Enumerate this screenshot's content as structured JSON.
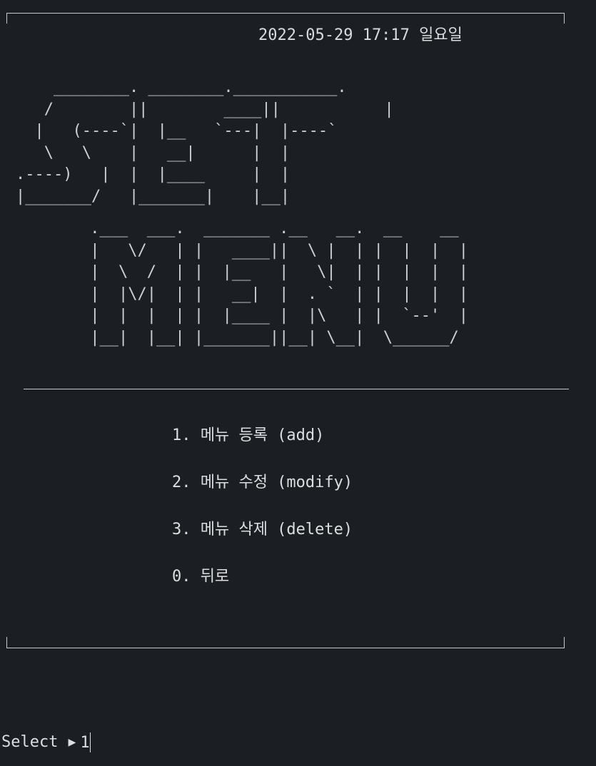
{
  "header": {
    "datetime": "2022-05-29 17:17 일요일"
  },
  "banner": {
    "set_art": "    ________. ________.___________.\n   /        ||        ____||           |\n  |   (----`|  |__   `---|  |----`\n   \\   \\    |   __|      |  |\n.----)   |  |  |____     |  |\n|_______/   |_______|    |__|",
    "menu_art": "     .___  ___.  _______ .__   __.  __    __\n     |   \\/   | |   ____||  \\ |  | |  |  |  |\n     |  \\  /  | |  |__   |   \\|  | |  |  |  |\n     |  |\\/|  | |   __|  |  . `  | |  |  |  |\n     |  |  |  | |  |____ |  |\\   | |  `--'  |\n     |__|  |__| |_______||__| \\__|  \\______/"
  },
  "menu": {
    "items": [
      {
        "label": "1. 메뉴 등록 (add)"
      },
      {
        "label": "2. 메뉴 수정 (modify)"
      },
      {
        "label": "3. 메뉴 삭제 (delete)"
      },
      {
        "label": "0. 뒤로"
      }
    ]
  },
  "prompt": {
    "label": "Select",
    "arrow": "▶",
    "value": "1"
  }
}
